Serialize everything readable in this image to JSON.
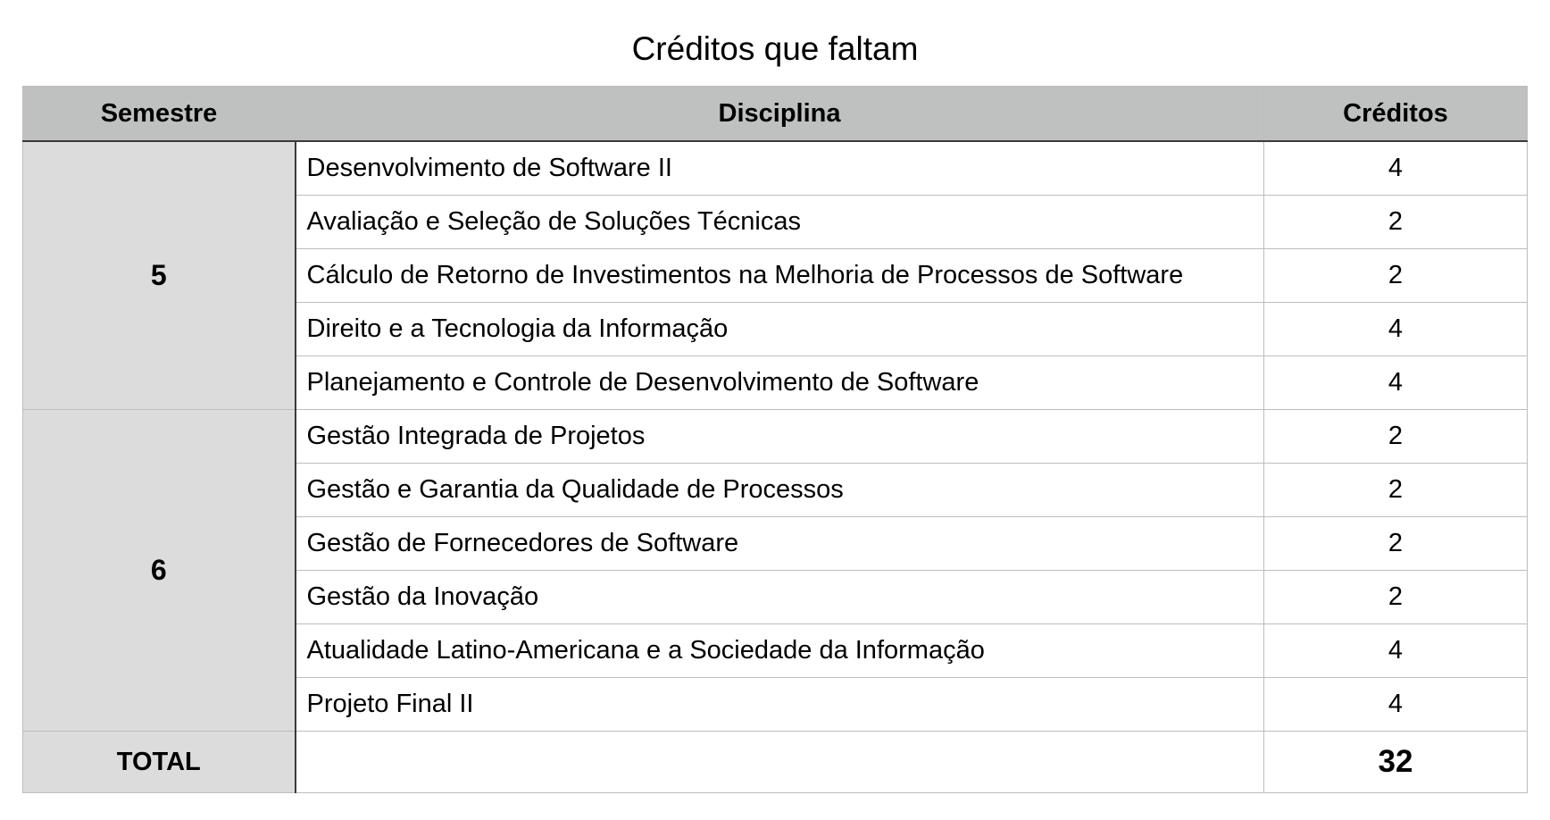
{
  "title": "Créditos que faltam",
  "columns": {
    "semester": "Semestre",
    "discipline": "Disciplina",
    "credits": "Créditos"
  },
  "groups": [
    {
      "semester": "5",
      "rows": [
        {
          "discipline": "Desenvolvimento de Software II",
          "credits": "4"
        },
        {
          "discipline": "Avaliação e Seleção de Soluções Técnicas",
          "credits": "2"
        },
        {
          "discipline": "Cálculo de Retorno de Investimentos na Melhoria de Processos de Software",
          "credits": "2"
        },
        {
          "discipline": "Direito e a Tecnologia da Informação",
          "credits": "4"
        },
        {
          "discipline": "Planejamento e Controle de Desenvolvimento de Software",
          "credits": "4"
        }
      ]
    },
    {
      "semester": "6",
      "rows": [
        {
          "discipline": "Gestão Integrada de Projetos",
          "credits": "2"
        },
        {
          "discipline": "Gestão e Garantia da Qualidade de Processos",
          "credits": "2"
        },
        {
          "discipline": "Gestão de Fornecedores de Software",
          "credits": "2"
        },
        {
          "discipline": "Gestão da Inovação",
          "credits": "2"
        },
        {
          "discipline": "Atualidade Latino-Americana e a Sociedade da Informação",
          "credits": "4"
        },
        {
          "discipline": "Projeto Final II",
          "credits": "4"
        }
      ]
    }
  ],
  "total": {
    "label": "TOTAL",
    "value": "32"
  },
  "colors": {
    "header_bg": "#bfc1c0",
    "semester_bg": "#dcdcdc",
    "grid_line": "#bdbdbd"
  }
}
